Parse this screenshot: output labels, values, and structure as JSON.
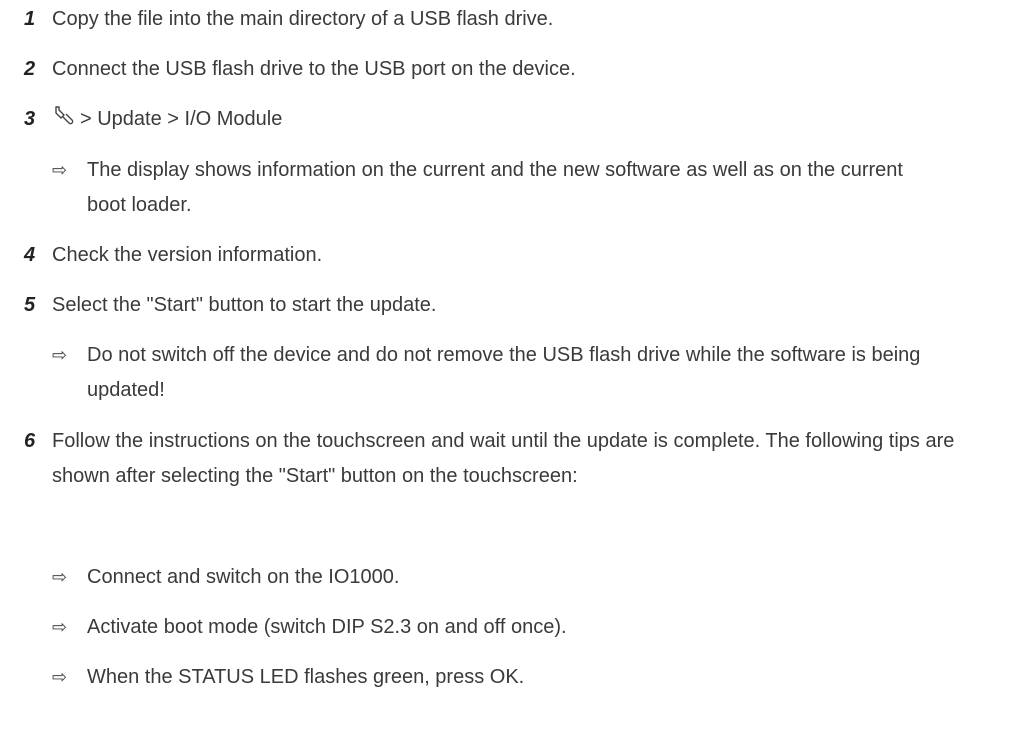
{
  "icons": {
    "result_arrow": "⇨",
    "settings": "wrench-icon"
  },
  "steps": [
    {
      "num": "1",
      "text": "Copy the file into the main directory of a USB flash drive."
    },
    {
      "num": "2",
      "text": "Connect the USB flash drive to the USB port on the device."
    },
    {
      "num": "3",
      "text": "> Update > I/O Module"
    },
    {
      "num": "4",
      "text": "Check the version information."
    },
    {
      "num": "5",
      "text": "Select the \"Start\" button to start the update."
    },
    {
      "num": "6",
      "text": "Follow the instructions on the touchscreen and wait until the update is complete. The following tips are shown after selecting the \"Start\" button on the touchscreen:"
    }
  ],
  "results": {
    "step3": "The display shows information on the current and the new software as well as on the current boot loader.",
    "step5": "Do not switch off the device and do not remove the USB flash drive while the software is being updated!",
    "step6": [
      "Connect and switch on the IO1000.",
      "Activate boot mode (switch DIP S2.3 on and off once).",
      "When the STATUS LED flashes green, press OK."
    ]
  }
}
